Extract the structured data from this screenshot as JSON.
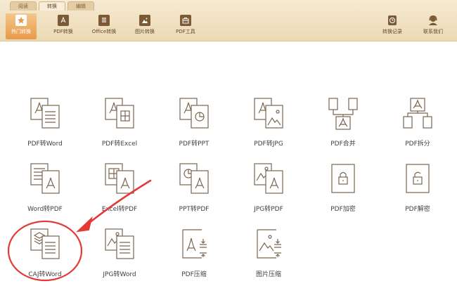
{
  "tabs": [
    {
      "label": "阅读",
      "active": false
    },
    {
      "label": "转换",
      "active": true
    },
    {
      "label": "编辑",
      "active": false
    }
  ],
  "tools": [
    {
      "label": "热门转换",
      "icon": "star-icon",
      "active": true
    },
    {
      "label": "PDF转换",
      "icon": "pdf-icon"
    },
    {
      "label": "Office转换",
      "icon": "document-icon"
    },
    {
      "label": "图片转换",
      "icon": "image-icon"
    },
    {
      "label": "PDF工具",
      "icon": "toolbox-icon"
    }
  ],
  "right_tools": [
    {
      "label": "转换记录",
      "icon": "history-icon"
    },
    {
      "label": "联系我们",
      "icon": "contact-icon"
    }
  ],
  "functions": [
    {
      "label": "PDF转Word",
      "icon": "pdf-to-word-icon"
    },
    {
      "label": "PDF转Excel",
      "icon": "pdf-to-excel-icon"
    },
    {
      "label": "PDF转PPT",
      "icon": "pdf-to-ppt-icon"
    },
    {
      "label": "PDF转JPG",
      "icon": "pdf-to-jpg-icon"
    },
    {
      "label": "PDF合并",
      "icon": "pdf-merge-icon"
    },
    {
      "label": "PDF拆分",
      "icon": "pdf-split-icon"
    },
    {
      "label": "Word转PDF",
      "icon": "word-to-pdf-icon"
    },
    {
      "label": "Excel转PDF",
      "icon": "excel-to-pdf-icon"
    },
    {
      "label": "PPT转PDF",
      "icon": "ppt-to-pdf-icon"
    },
    {
      "label": "JPG转PDF",
      "icon": "jpg-to-pdf-icon"
    },
    {
      "label": "PDF加密",
      "icon": "pdf-encrypt-icon"
    },
    {
      "label": "PDF解密",
      "icon": "pdf-decrypt-icon"
    },
    {
      "label": "CAJ转Word",
      "icon": "caj-to-word-icon"
    },
    {
      "label": "JPG转Word",
      "icon": "jpg-to-word-icon"
    },
    {
      "label": "PDF压缩",
      "icon": "pdf-compress-icon"
    },
    {
      "label": "图片压缩",
      "icon": "image-compress-icon"
    }
  ],
  "colors": {
    "accent": "#e89a48",
    "icon_stroke": "#7a6652",
    "annotation": "#e53935"
  }
}
